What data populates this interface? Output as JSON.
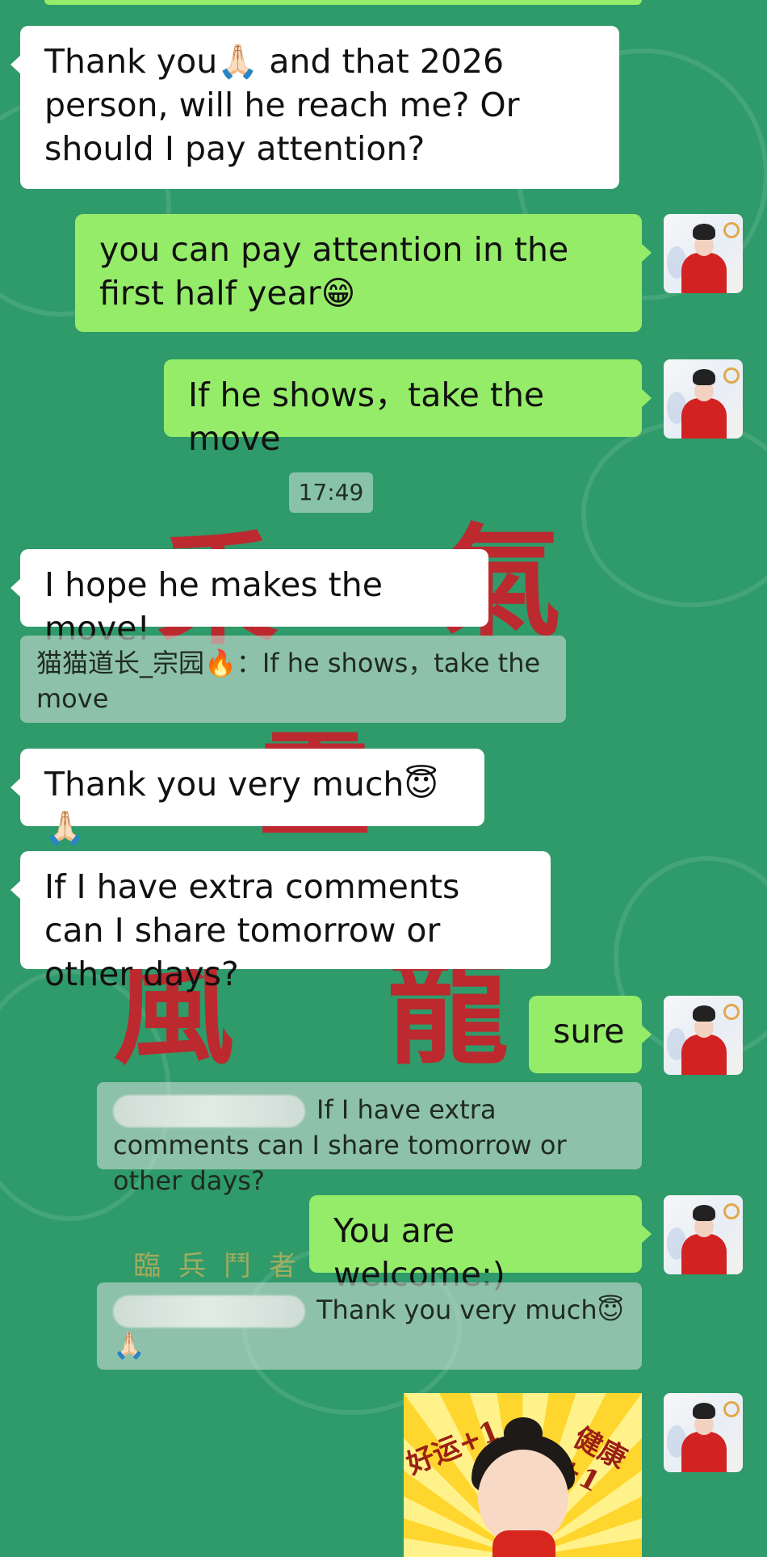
{
  "messages": [
    {
      "id": "m1",
      "side": "in",
      "text": "Thank you🙏🏻 and that 2026 person, will he reach me? Or should I pay attention?"
    },
    {
      "id": "m2",
      "side": "out",
      "text": "you can pay attention in the first half year😁"
    },
    {
      "id": "m3",
      "side": "out",
      "text": "If he shows，take the move"
    },
    {
      "id": "m4",
      "side": "in",
      "text": "I hope he makes the move!"
    },
    {
      "id": "m5",
      "side": "in",
      "text": "Thank you very much😇🙏🏻"
    },
    {
      "id": "m6",
      "side": "in",
      "text": "If I have extra comments can I share tomorrow or other days?"
    },
    {
      "id": "m7",
      "side": "out",
      "text": "sure"
    },
    {
      "id": "m8",
      "side": "out",
      "text": "You are welcome:)"
    }
  ],
  "timestamp": "17:49",
  "quotes": {
    "q1": {
      "author": "猫猫道长_宗园🔥：",
      "text": "If he shows，take the move"
    },
    "q2": {
      "text": "If I have extra comments can I share tomorrow or other days?"
    },
    "q3": {
      "text": "Thank you very much😇🙏🏻"
    }
  },
  "sticker": {
    "left_text": "好运+1",
    "right_text": "健康+1"
  },
  "background": {
    "chars": [
      "臨",
      "兵",
      "鬥",
      "者"
    ]
  },
  "colors": {
    "background": "#2f9a6a",
    "incoming_bubble": "#ffffff",
    "outgoing_bubble": "#95ec69"
  }
}
